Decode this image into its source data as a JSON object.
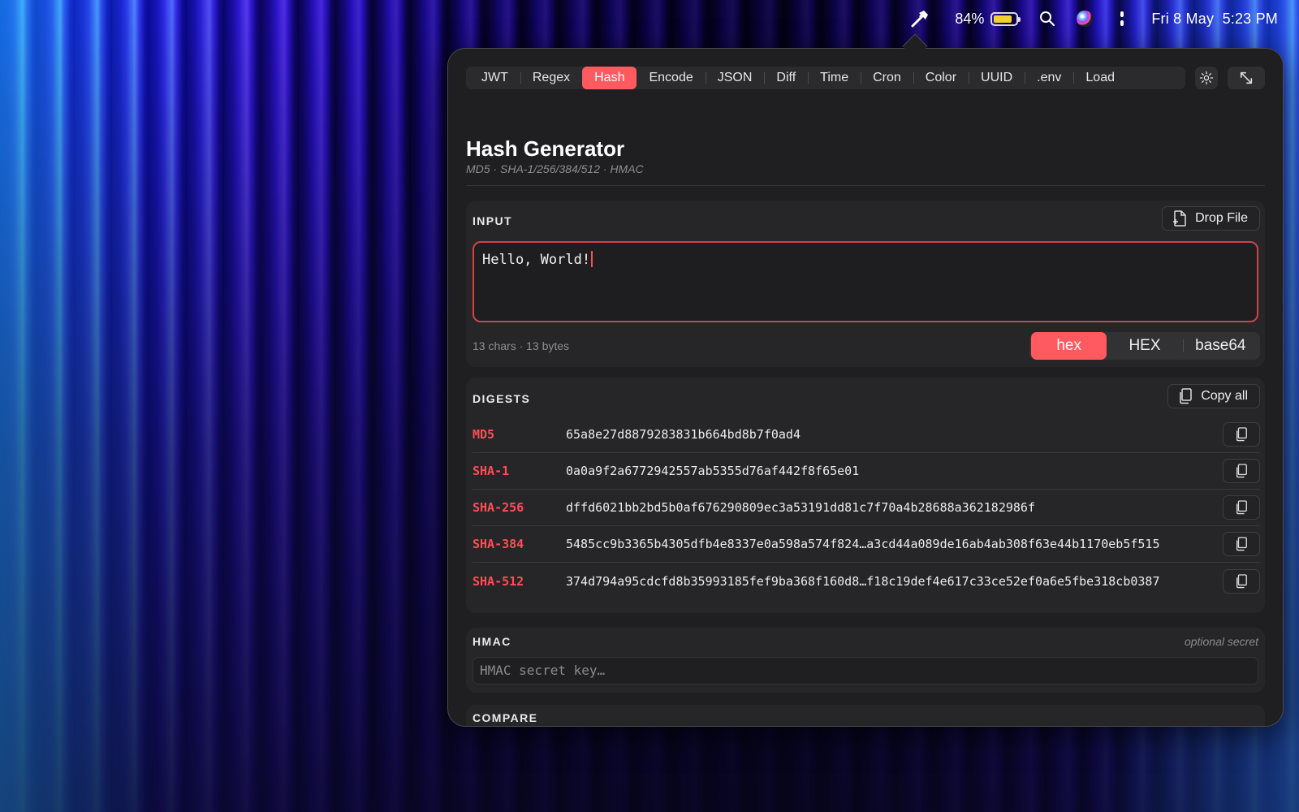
{
  "menubar": {
    "battery_percent": "84%",
    "battery_level": 0.84,
    "date": "Fri 8 May",
    "time": "5:23 PM"
  },
  "tabs": [
    {
      "label": "JWT",
      "active": false
    },
    {
      "label": "Regex",
      "active": false
    },
    {
      "label": "Hash",
      "active": true
    },
    {
      "label": "Encode",
      "active": false
    },
    {
      "label": "JSON",
      "active": false
    },
    {
      "label": "Diff",
      "active": false
    },
    {
      "label": "Time",
      "active": false
    },
    {
      "label": "Cron",
      "active": false
    },
    {
      "label": "Color",
      "active": false
    },
    {
      "label": "UUID",
      "active": false
    },
    {
      "label": ".env",
      "active": false
    },
    {
      "label": "Load",
      "active": false
    }
  ],
  "header": {
    "title": "Hash Generator",
    "subtitle": "MD5 · SHA-1/256/384/512 · HMAC"
  },
  "input": {
    "label": "INPUT",
    "drop_file_label": "Drop File",
    "value": "Hello, World!",
    "meta": "13 chars · 13 bytes",
    "formats": [
      {
        "label": "hex",
        "active": true
      },
      {
        "label": "HEX",
        "active": false
      },
      {
        "label": "base64",
        "active": false
      }
    ]
  },
  "digests": {
    "label": "DIGESTS",
    "copy_all_label": "Copy all",
    "rows": [
      {
        "algo": "MD5",
        "hash": "65a8e27d8879283831b664bd8b7f0ad4"
      },
      {
        "algo": "SHA-1",
        "hash": "0a0a9f2a6772942557ab5355d76af442f8f65e01"
      },
      {
        "algo": "SHA-256",
        "hash": "dffd6021bb2bd5b0af676290809ec3a53191dd81c7f70a4b28688a362182986f"
      },
      {
        "algo": "SHA-384",
        "hash": "5485cc9b3365b4305dfb4e8337e0a598a574f824…a3cd44a089de16ab4ab308f63e44b1170eb5f515"
      },
      {
        "algo": "SHA-512",
        "hash": "374d794a95cdcfd8b35993185fef9ba368f160d8…f18c19def4e617c33ce52ef0a6e5fbe318cb0387"
      }
    ]
  },
  "hmac": {
    "label": "HMAC",
    "hint": "optional secret",
    "placeholder": "HMAC secret key…"
  },
  "compare": {
    "label": "COMPARE"
  },
  "colors": {
    "accent": "#ff5a5f",
    "algo_text": "#ff4d55",
    "panel_bg": "#1f1f21"
  }
}
